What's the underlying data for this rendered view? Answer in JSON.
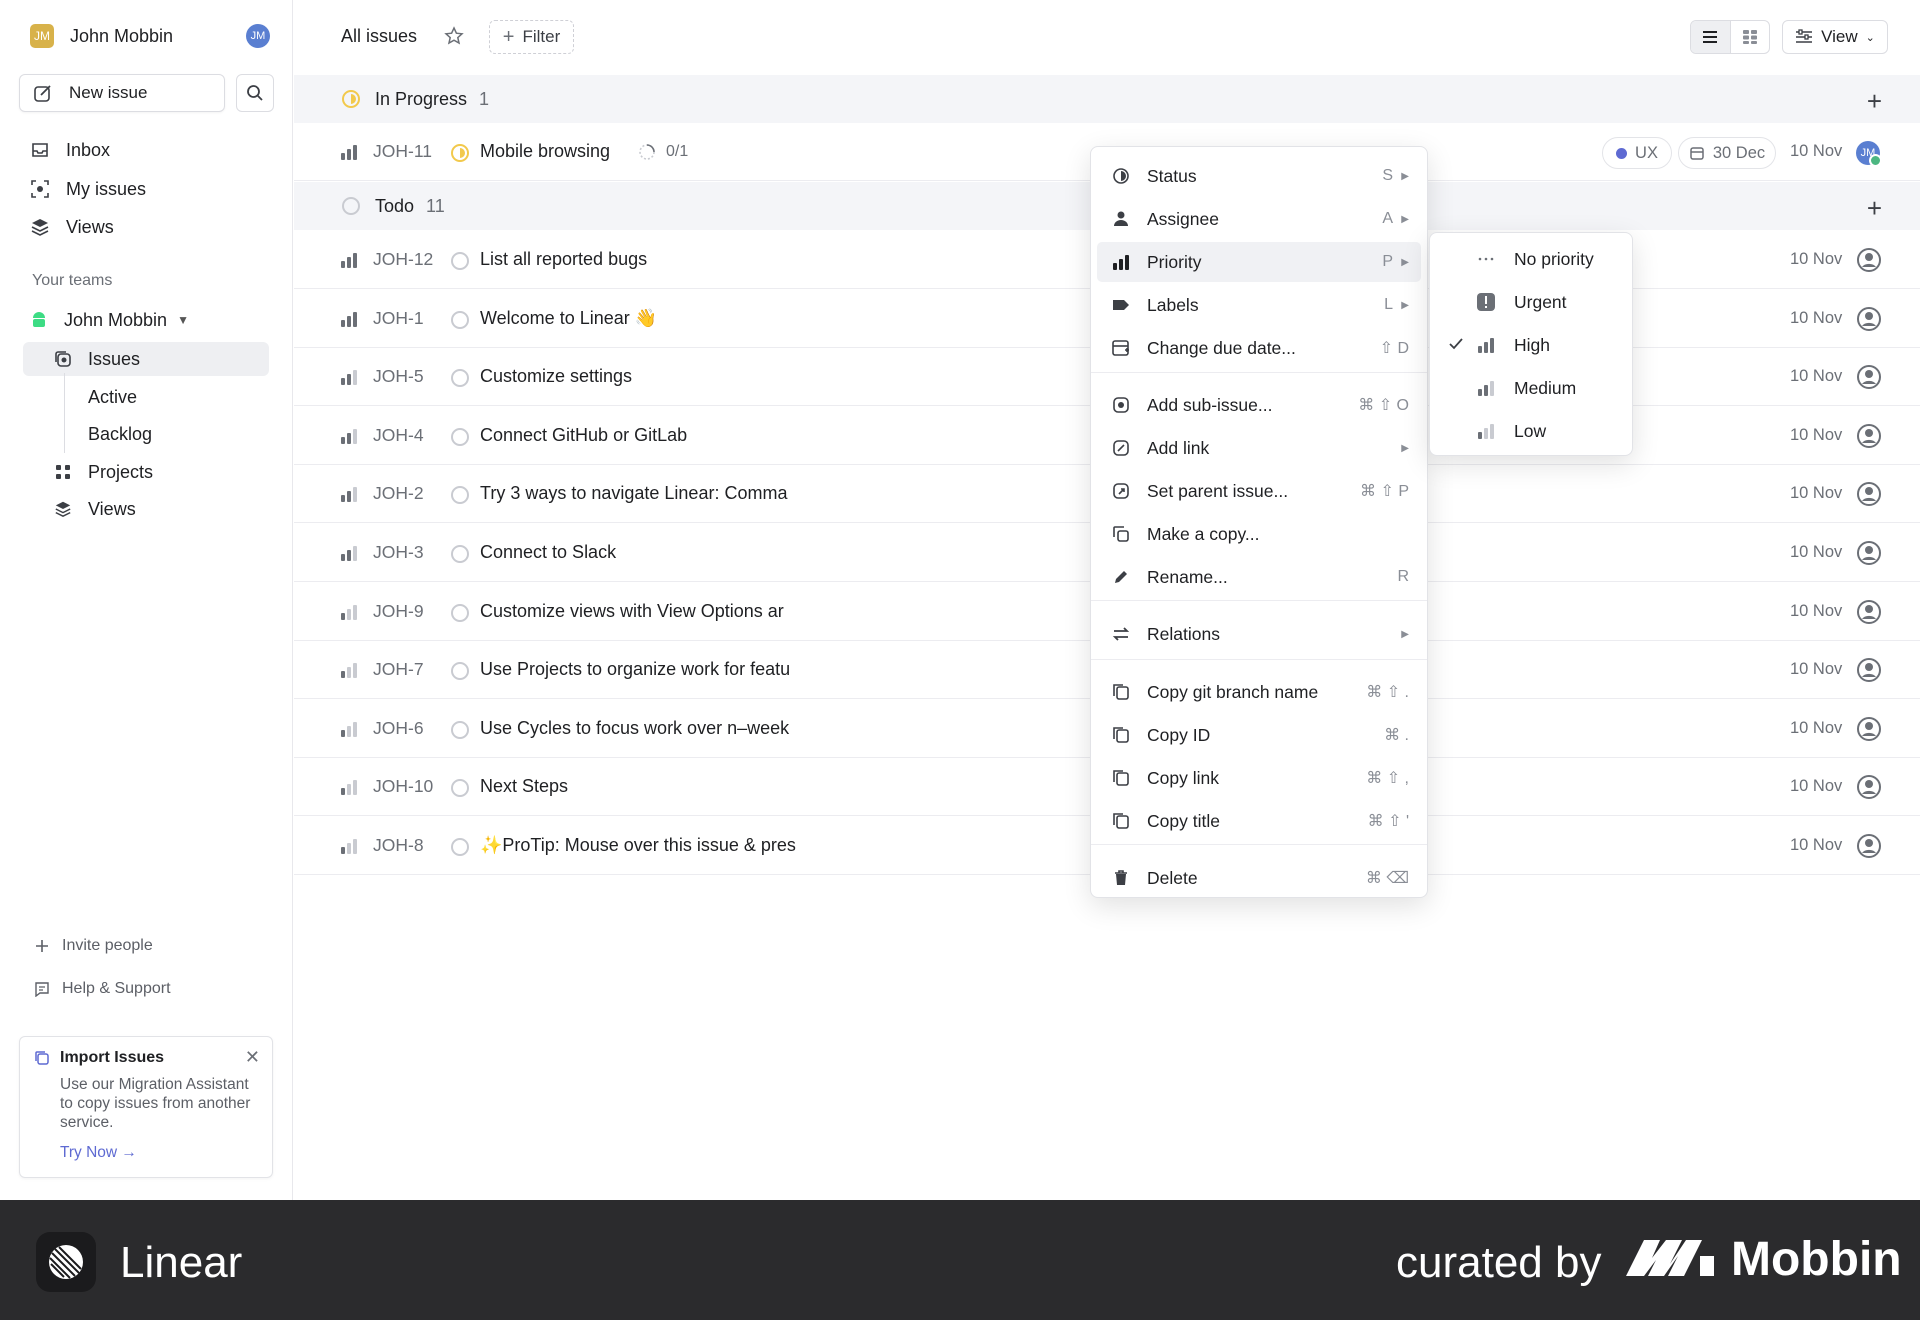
{
  "sidebar": {
    "workspace_initials": "JM",
    "workspace_name": "John Mobbin",
    "user_initials": "JM",
    "new_issue_label": "New issue",
    "nav": [
      {
        "label": "Inbox",
        "icon": "inbox-icon"
      },
      {
        "label": "My issues",
        "icon": "my-issues-icon"
      },
      {
        "label": "Views",
        "icon": "views-icon"
      }
    ],
    "teams_label": "Your teams",
    "team_name": "John Mobbin",
    "team_items": [
      {
        "label": "Issues",
        "active": true
      },
      {
        "label": "Active"
      },
      {
        "label": "Backlog"
      },
      {
        "label": "Projects"
      },
      {
        "label": "Views"
      }
    ],
    "invite_label": "Invite people",
    "help_label": "Help & Support",
    "import_card": {
      "title": "Import Issues",
      "body": "Use our Migration Assistant to copy issues from another service.",
      "link": "Try Now →"
    }
  },
  "header": {
    "title": "All issues",
    "filter_label": "Filter",
    "view_label": "View"
  },
  "groups": {
    "in_progress": {
      "label": "In Progress",
      "count": "1"
    },
    "todo": {
      "label": "Todo",
      "count": "11"
    }
  },
  "in_progress_issue": {
    "id": "JOH-11",
    "title": "Mobile browsing",
    "subissues": "0/1",
    "label": "UX",
    "due": "30 Dec",
    "created": "10 Nov",
    "assignee_initials": "JM"
  },
  "todo_issues": [
    {
      "id": "JOH-12",
      "title": "List all reported bugs",
      "created": "10 Nov",
      "priority": "high"
    },
    {
      "id": "JOH-1",
      "title": "Welcome to Linear 👋",
      "created": "10 Nov",
      "priority": "high"
    },
    {
      "id": "JOH-5",
      "title": "Customize settings",
      "created": "10 Nov",
      "priority": "medium"
    },
    {
      "id": "JOH-4",
      "title": "Connect GitHub or GitLab",
      "created": "10 Nov",
      "priority": "medium"
    },
    {
      "id": "JOH-2",
      "title": "Try 3 ways to navigate Linear: Comma",
      "created": "10 Nov",
      "priority": "medium"
    },
    {
      "id": "JOH-3",
      "title": "Connect to Slack",
      "created": "10 Nov",
      "priority": "medium"
    },
    {
      "id": "JOH-9",
      "title": "Customize views with View Options ar",
      "created": "10 Nov",
      "priority": "low"
    },
    {
      "id": "JOH-7",
      "title": "Use Projects to organize work for featu",
      "created": "10 Nov",
      "priority": "low"
    },
    {
      "id": "JOH-6",
      "title": "Use Cycles to focus work over n–week",
      "created": "10 Nov",
      "priority": "low"
    },
    {
      "id": "JOH-10",
      "title": "Next Steps",
      "created": "10 Nov",
      "priority": "low"
    },
    {
      "id": "JOH-8",
      "title": "✨ProTip: Mouse over this issue & pres",
      "created": "10 Nov",
      "priority": "low"
    }
  ],
  "context_menu": {
    "items": [
      {
        "label": "Status",
        "shortcut": "S",
        "submenu": true,
        "icon": "status-icon"
      },
      {
        "label": "Assignee",
        "shortcut": "A",
        "submenu": true,
        "icon": "assignee-icon"
      },
      {
        "label": "Priority",
        "shortcut": "P",
        "submenu": true,
        "icon": "priority-icon",
        "highlighted": true
      },
      {
        "label": "Labels",
        "shortcut": "L",
        "submenu": true,
        "icon": "label-icon"
      },
      {
        "label": "Change due date...",
        "shortcut": "⇧ D",
        "submenu": false,
        "icon": "calendar-icon"
      },
      {
        "label": "Add sub-issue...",
        "shortcut": "⌘ ⇧ O",
        "submenu": false,
        "icon": "sub-issue-icon"
      },
      {
        "label": "Add link",
        "shortcut": "",
        "submenu": true,
        "icon": "link-icon"
      },
      {
        "label": "Set parent issue...",
        "shortcut": "⌘ ⇧ P",
        "submenu": false,
        "icon": "parent-issue-icon"
      },
      {
        "label": "Make a copy...",
        "shortcut": "",
        "submenu": false,
        "icon": "copy-icon"
      },
      {
        "label": "Rename...",
        "shortcut": "R",
        "submenu": false,
        "icon": "pencil-icon"
      },
      {
        "label": "Relations",
        "shortcut": "",
        "submenu": true,
        "icon": "relations-icon"
      },
      {
        "label": "Copy git branch name",
        "shortcut": "⌘ ⇧ .",
        "submenu": false,
        "icon": "git-branch-icon"
      },
      {
        "label": "Copy ID",
        "shortcut": "⌘ .",
        "submenu": false,
        "icon": "copy-id-icon"
      },
      {
        "label": "Copy link",
        "shortcut": "⌘ ⇧ ,",
        "submenu": false,
        "icon": "copy-link-icon"
      },
      {
        "label": "Copy title",
        "shortcut": "⌘ ⇧ '",
        "submenu": false,
        "icon": "copy-title-icon"
      },
      {
        "label": "Delete",
        "shortcut": "⌘ ⌫",
        "submenu": false,
        "icon": "trash-icon"
      }
    ]
  },
  "priority_submenu": {
    "items": [
      {
        "label": "No priority",
        "checked": false
      },
      {
        "label": "Urgent",
        "checked": false
      },
      {
        "label": "High",
        "checked": true
      },
      {
        "label": "Medium",
        "checked": false
      },
      {
        "label": "Low",
        "checked": false
      }
    ]
  },
  "footer": {
    "brand": "Linear",
    "curated_by": "curated by",
    "curator": "Mobbin"
  },
  "colors": {
    "accent": "#5e6ad2",
    "in_progress": "#f2c94c",
    "footer_bg": "#2b2b2d"
  }
}
